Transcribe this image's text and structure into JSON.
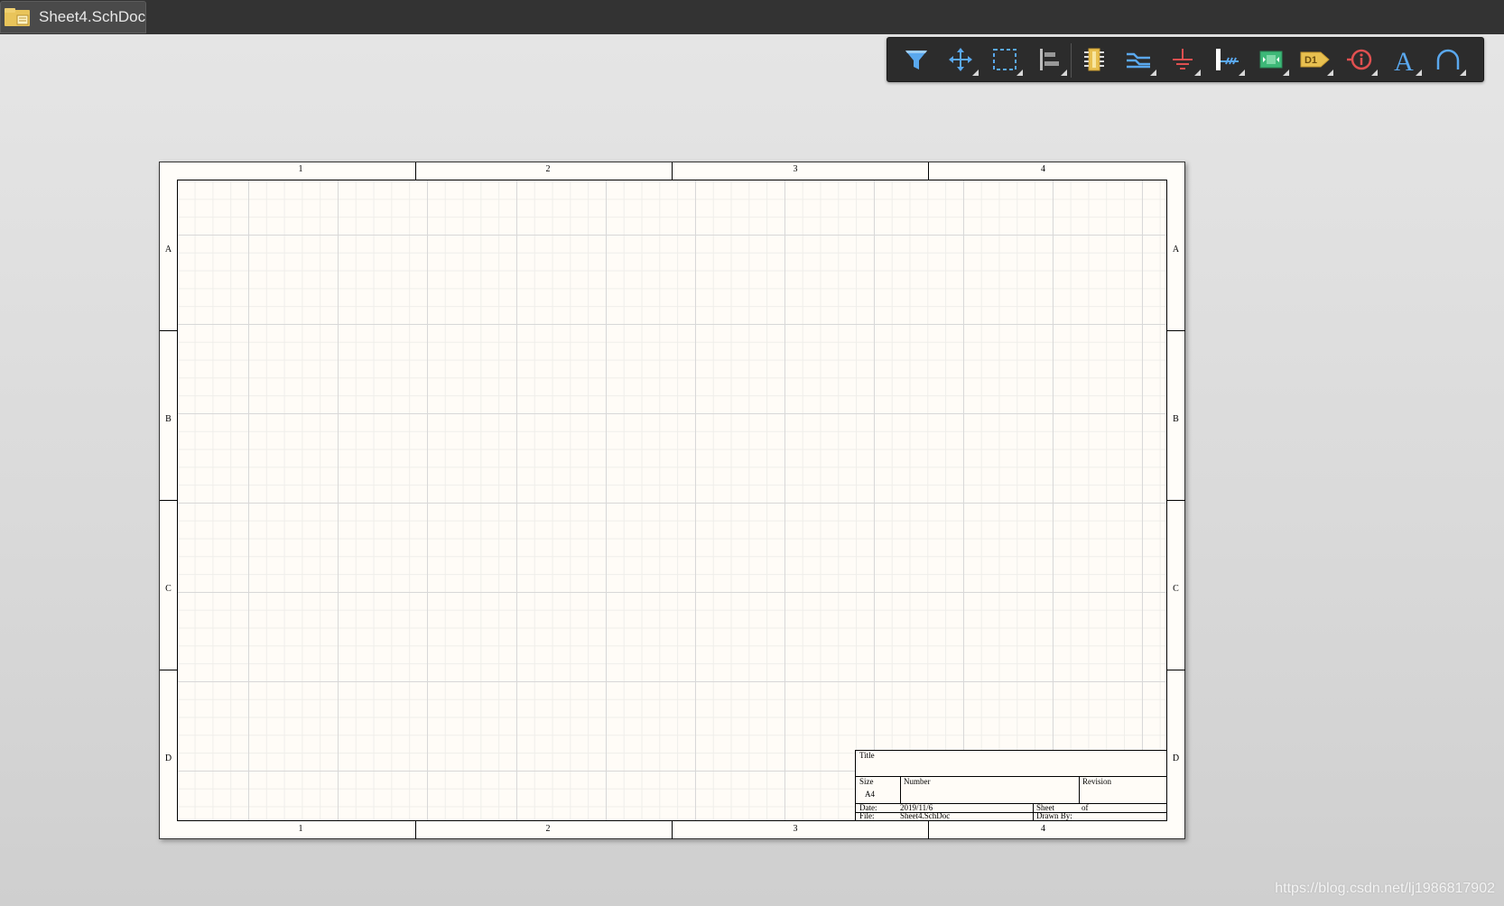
{
  "tab": {
    "label": "Sheet4.SchDoc",
    "icon": "schematic-doc-icon"
  },
  "toolbar": {
    "tools": [
      {
        "name": "filter",
        "icon": "funnel-icon"
      },
      {
        "name": "move",
        "icon": "move-cross-icon"
      },
      {
        "name": "select",
        "icon": "selection-rectangle-icon"
      },
      {
        "name": "align",
        "icon": "align-left-icon"
      },
      {
        "name": "place-part",
        "icon": "ic-chip-icon"
      },
      {
        "name": "wire",
        "icon": "wire-bus-icon"
      },
      {
        "name": "power-port",
        "icon": "ground-icon"
      },
      {
        "name": "harness",
        "icon": "harness-connector-icon"
      },
      {
        "name": "sheet-symbol",
        "icon": "sheet-symbol-icon"
      },
      {
        "name": "port",
        "icon": "port-d1-icon",
        "label": "D1"
      },
      {
        "name": "directive",
        "icon": "info-directive-icon"
      },
      {
        "name": "text",
        "icon": "text-a-icon",
        "label": "A"
      },
      {
        "name": "arc",
        "icon": "arc-icon"
      }
    ]
  },
  "sheet": {
    "columns": [
      "1",
      "2",
      "3",
      "4"
    ],
    "rows": [
      "A",
      "B",
      "C",
      "D"
    ],
    "title_block": {
      "title_label": "Title",
      "size_label": "Size",
      "size_value": "A4",
      "number_label": "Number",
      "revision_label": "Revision",
      "date_label": "Date:",
      "date_value": "2019/11/6",
      "sheet_label": "Sheet",
      "of_label": "of",
      "file_label": "File:",
      "file_value": "Sheet4.SchDoc",
      "drawn_by_label": "Drawn By:"
    }
  },
  "watermark": "https://blog.csdn.net/lj1986817902",
  "colors": {
    "accent_blue": "#4a9ae8",
    "chip_yellow": "#e8c050",
    "ground_red": "#e05050",
    "sheet_bg": "#fffdf9"
  }
}
